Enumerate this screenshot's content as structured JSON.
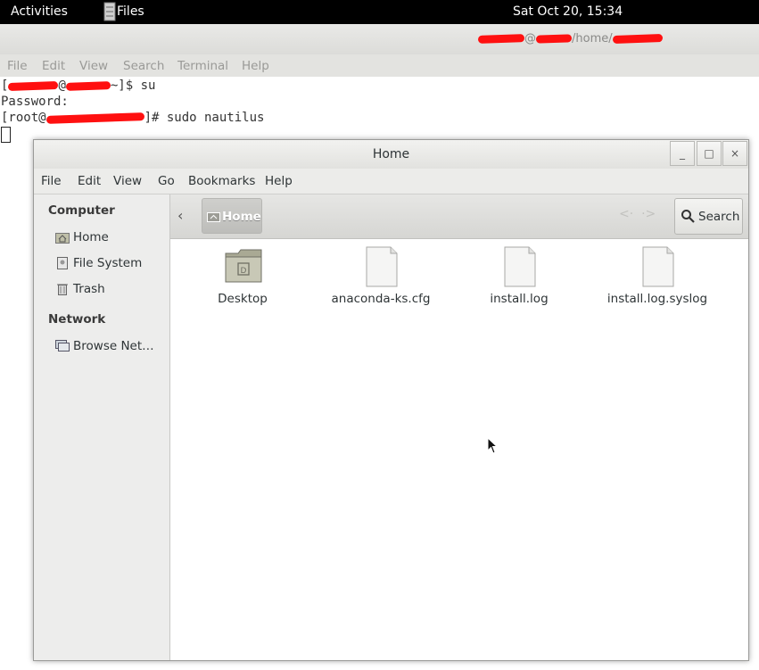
{
  "topbar": {
    "activities": "Activities",
    "app_name": "Files",
    "clock": "Sat Oct 20, 15:34"
  },
  "terminal": {
    "title_suffix": "/home/",
    "title_at": "@",
    "menu": [
      "File",
      "Edit",
      "View",
      "Search",
      "Terminal",
      "Help"
    ],
    "lines": {
      "l1_open": "[",
      "l1_at": "@",
      "l1_rest": "~]$ su",
      "l2": "Password:",
      "l3_open": "[root@",
      "l3_rest": "]# sudo nautilus"
    }
  },
  "nautilus": {
    "title": "Home",
    "window_buttons": {
      "minimize": "_",
      "maximize": "□",
      "close": "×"
    },
    "menu": [
      "File",
      "Edit",
      "View",
      "Go",
      "Bookmarks",
      "Help"
    ],
    "sidebar": {
      "sections": [
        {
          "title": "Computer",
          "items": [
            {
              "label": "Home",
              "icon": "home-folder-icon"
            },
            {
              "label": "File System",
              "icon": "drive-icon"
            },
            {
              "label": "Trash",
              "icon": "trash-icon"
            }
          ]
        },
        {
          "title": "Network",
          "items": [
            {
              "label": "Browse Net…",
              "icon": "network-icon"
            }
          ]
        }
      ]
    },
    "toolbar": {
      "back": "‹",
      "breadcrumb": "Home",
      "prev_arrow": "<·",
      "next_arrow": "·>",
      "search_label": "Search"
    },
    "files": [
      {
        "name": "Desktop",
        "type": "folder"
      },
      {
        "name": "anaconda-ks.cfg",
        "type": "file"
      },
      {
        "name": "install.log",
        "type": "file"
      },
      {
        "name": "install.log.syslog",
        "type": "file"
      }
    ]
  }
}
